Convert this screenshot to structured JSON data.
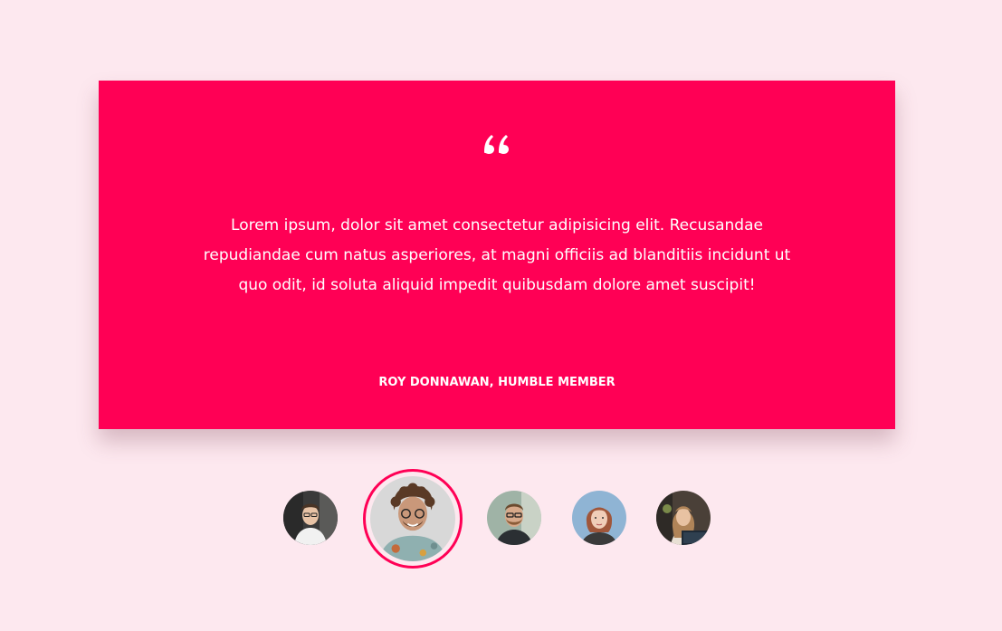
{
  "testimonial": {
    "quote_icon": "quote-left-icon",
    "text": "Lorem ipsum, dolor sit amet consectetur adipisicing elit. Recusandae repudiandae cum natus asperiores, at magni officiis ad blanditiis incidunt ut quo odit, id soluta aliquid impedit quibusdam dolore amet suscipit!",
    "author": "ROY DONNAWAN, HUMBLE MEMBER"
  },
  "avatars": {
    "active_index": 1,
    "count": 5
  },
  "colors": {
    "background": "#fde8ef",
    "accent": "#ff0055",
    "text": "#ffffff"
  }
}
